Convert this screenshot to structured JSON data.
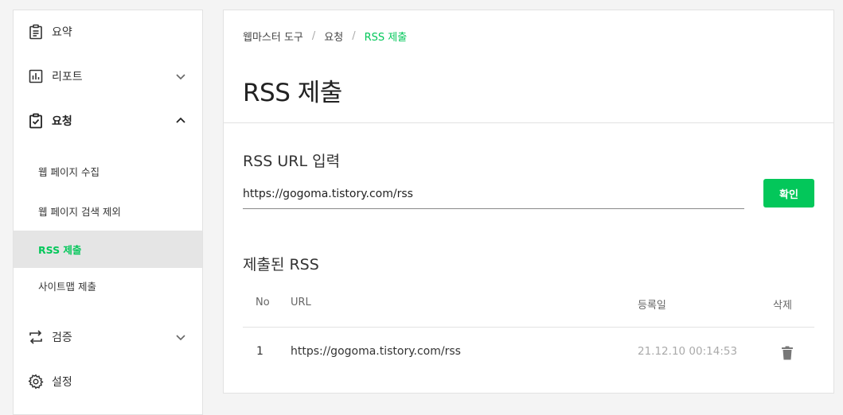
{
  "sidebar": {
    "items": [
      {
        "label": "요약",
        "icon": "clipboard-icon"
      },
      {
        "label": "리포트",
        "icon": "bar-chart-icon"
      },
      {
        "label": "요청",
        "icon": "clipboard-check-icon"
      },
      {
        "label": "검증",
        "icon": "repeat-icon"
      },
      {
        "label": "설정",
        "icon": "gear-icon"
      }
    ],
    "sub_items": [
      {
        "label": "웹 페이지 수집"
      },
      {
        "label": "웹 페이지 검색 제외"
      },
      {
        "label": "RSS 제출"
      },
      {
        "label": "사이트맵 제출"
      }
    ]
  },
  "breadcrumb": {
    "items": [
      "웹마스터 도구",
      "요청",
      "RSS 제출"
    ],
    "separator": "/"
  },
  "page": {
    "title": "RSS 제출",
    "input_section_title": "RSS URL 입력",
    "url_value": "https://gogoma.tistory.com/rss",
    "confirm_label": "확인",
    "submitted_section_title": "제출된 RSS"
  },
  "table": {
    "headers": {
      "no": "No",
      "url": "URL",
      "date": "등록일",
      "delete": "삭제"
    },
    "rows": [
      {
        "no": "1",
        "url": "https://gogoma.tistory.com/rss",
        "date": "21.12.10 00:14:53"
      }
    ]
  },
  "colors": {
    "accent": "#03c75a",
    "active_bg": "#e5e5e5"
  }
}
